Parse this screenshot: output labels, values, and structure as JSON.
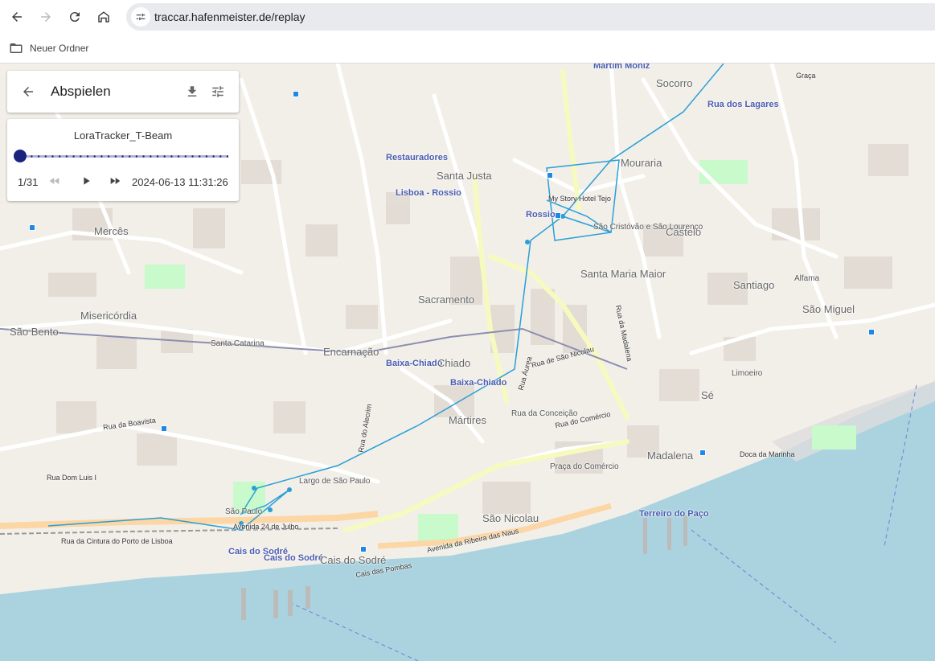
{
  "browser": {
    "url": "traccar.hafenmeister.de/replay",
    "bookmark_label": "Neuer Ordner"
  },
  "replay": {
    "title": "Abspielen",
    "device_name": "LoraTracker_T-Beam",
    "position_counter": "1/31",
    "timestamp": "2024-06-13 11:31:26",
    "progress_fraction": 0
  },
  "map": {
    "labels": {
      "martim_moniz": "Martim Moniz",
      "socorro": "Socorro",
      "graca": "Graça",
      "rua_dos_lagares": "Rua dos Lagares",
      "restauradores": "Restauradores",
      "lisboa_rossio": "Lisboa - Rossio",
      "santa_justa": "Santa Justa",
      "rossio": "Rossio",
      "hotel": "My Story Hotel Tejo",
      "mouraria": "Mouraria",
      "castelo": "Castelo",
      "sao_cristovao": "São Cristóvão e São Lourenço",
      "santa_maria_maior": "Santa Maria Maior",
      "merces": "Mercês",
      "misericordia": "Misericórdia",
      "sao_bento": "São Bento",
      "santa_catarina": "Santa Catarina",
      "sacramento": "Sacramento",
      "encarnacao": "Encarnação",
      "baixa_chiado": "Baixa-Chiado",
      "baixa_chiado2": "Baixa-Chiado",
      "chiado": "Chiado",
      "martires": "Mártires",
      "santiago": "Santiago",
      "sao_miguel": "São Miguel",
      "se": "Sé",
      "madalena": "Madalena",
      "doca_marinha": "Doca da Marinha",
      "terreiro_paco": "Terreiro do Paço",
      "cais_sodre": "Cais do Sodré",
      "cais_sodre2": "Cais do Sodré",
      "cais_sodre3": "Cais do Sodré",
      "sao_paulo": "São Paulo",
      "sao_nicolau": "São Nicolau",
      "praca_comercio": "Praça do Comércio",
      "av_24_julho": "Avenida 24 de Julho",
      "rua_dom_luis": "Rua Dom Luis I",
      "rua_cintura": "Rua da Cintura do Porto de Lisboa",
      "av_ribeira": "Avenida da Ribeira das Naus",
      "rua_boavista": "Rua da Boavista",
      "rua_alecrim": "Rua do Alecrim",
      "rua_aurea": "Rua Áurea",
      "rua_comercio": "Rua do Comércio",
      "rua_sao_nicolau": "Rua de São Nicolau",
      "rua_madalena": "Rua da Madalena",
      "rua_conceicao": "Rua da Conceição",
      "largo_sao_paulo": "Largo de São Paulo",
      "cais_pombas": "Cais das Pombas",
      "limoeiro": "Limoeiro",
      "alfama": "Alfama"
    }
  },
  "colors": {
    "track": "#2a9fd6",
    "slider": "#1a237e",
    "water": "#aad3df",
    "land": "#f2efe9",
    "road": "#ffffff",
    "primary_road": "#f7fabf",
    "park": "#c8facc"
  },
  "icons": {
    "back": "arrow-left-icon",
    "forward": "arrow-right-icon",
    "reload": "reload-icon",
    "home": "home-icon",
    "site_info": "tune-icon",
    "folder": "folder-icon",
    "download": "download-icon",
    "settings": "tune-icon",
    "rewind": "fast-rewind-icon",
    "play": "play-icon",
    "fast_forward": "fast-forward-icon"
  }
}
